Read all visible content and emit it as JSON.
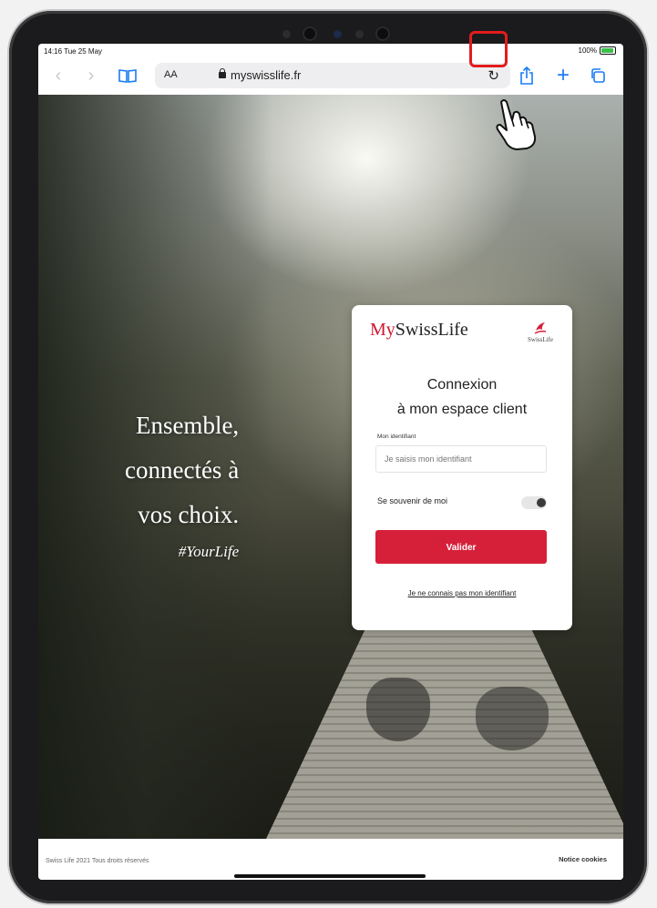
{
  "status_bar": {
    "time": "14:16  Tue 25 May",
    "battery": "100%"
  },
  "browser": {
    "text_size": "AA",
    "url": "myswisslife.fr"
  },
  "hero": {
    "tagline_lines": [
      "Ensemble,",
      "connectés à",
      "vos choix."
    ],
    "hashtag": "#YourLife"
  },
  "login": {
    "brand_prefix": "My",
    "brand_name": "SwissLife",
    "logo_caption": "SwissLife",
    "title_line1": "Connexion",
    "title_line2": "à mon espace client",
    "id_label": "Mon identifiant",
    "id_placeholder": "Je saisis mon identifiant",
    "remember_label": "Se souvenir de moi",
    "submit_label": "Valider",
    "forgot_link": "Je ne connais pas mon identifiant"
  },
  "footer": {
    "copyright": "Swiss Life 2021 Tous droits réservés",
    "cookies_link": "Notice cookies"
  },
  "colors": {
    "brand_red": "#d6203a",
    "safari_blue": "#1a7cf5",
    "highlight_red": "#e21c1c"
  },
  "icons": [
    "back-icon",
    "forward-icon",
    "bookmarks-icon",
    "lock-icon",
    "reload-icon",
    "share-icon",
    "new-tab-icon",
    "tabs-icon",
    "pointer-hand-icon"
  ]
}
